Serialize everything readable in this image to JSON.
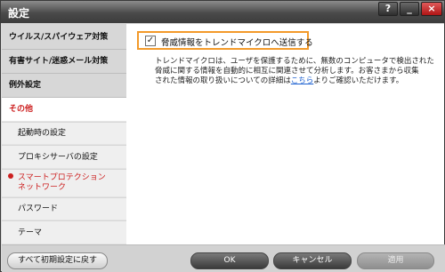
{
  "window": {
    "title": "設定",
    "help_label": "?",
    "minimize_label": "_",
    "close_label": "×"
  },
  "sidebar": {
    "items": [
      {
        "label": "ウイルス/スパイウェア対策"
      },
      {
        "label": "有害サイト/迷惑メール対策"
      },
      {
        "label": "例外設定"
      },
      {
        "label": "その他"
      }
    ],
    "subitems": [
      {
        "label": "起動時の設定"
      },
      {
        "label": "プロキシサーバの設定"
      },
      {
        "label_line1": "スマートプロテクション",
        "label_line2": "ネットワーク"
      },
      {
        "label": "パスワード"
      },
      {
        "label": "テーマ"
      }
    ]
  },
  "content": {
    "checkbox": {
      "checked": true,
      "mark": "✓",
      "label": "脅威情報をトレンドマイクロへ送信する"
    },
    "description": {
      "line1": "トレンドマイクロは、ユーザを保護するために、無数のコンピュータで検出された",
      "line2": "脅威に関する情報を自動的に相互に関連させて分析します。お客さまから収集",
      "line3_before": "された情報の取り扱いについての詳細は",
      "link": "こちら",
      "line3_after": "よりご確認いただけます。"
    }
  },
  "footer": {
    "reset_label": "すべて初期設定に戻す",
    "ok_label": "OK",
    "cancel_label": "キャンセル",
    "apply_label": "適用"
  }
}
